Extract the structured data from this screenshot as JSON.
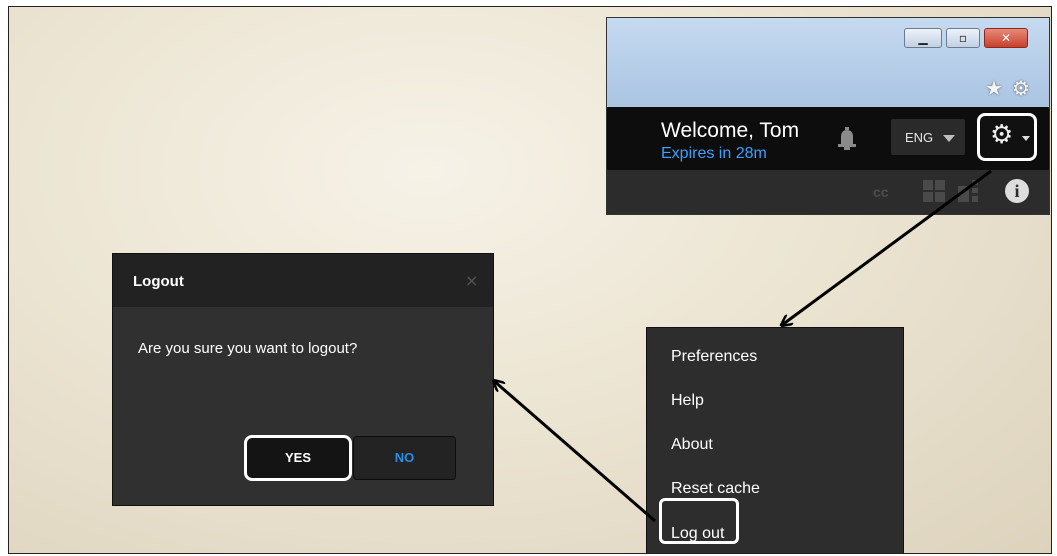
{
  "browser": {
    "window_controls": {
      "minimize_icon": "minimize-icon",
      "maximize_icon": "maximize-icon",
      "close_icon": "close-icon"
    },
    "favorites_icon": "star-icon",
    "tools_icon": "gear-icon"
  },
  "header": {
    "welcome_text": "Welcome, Tom",
    "expires_text": "Expires in 28m",
    "language": "ENG",
    "expires_color": "#3aa0ff"
  },
  "toolbar": {
    "cc_label": "cc",
    "info_label": "i"
  },
  "dialog": {
    "title": "Logout",
    "close_glyph": "×",
    "message": "Are you sure you want to logout?",
    "yes_label": "YES",
    "no_label": "NO",
    "no_color": "#2a8de8"
  },
  "menu": {
    "items": [
      {
        "label": "Preferences"
      },
      {
        "label": "Help"
      },
      {
        "label": "About"
      },
      {
        "label": "Reset cache"
      },
      {
        "label": "Log out"
      }
    ]
  }
}
